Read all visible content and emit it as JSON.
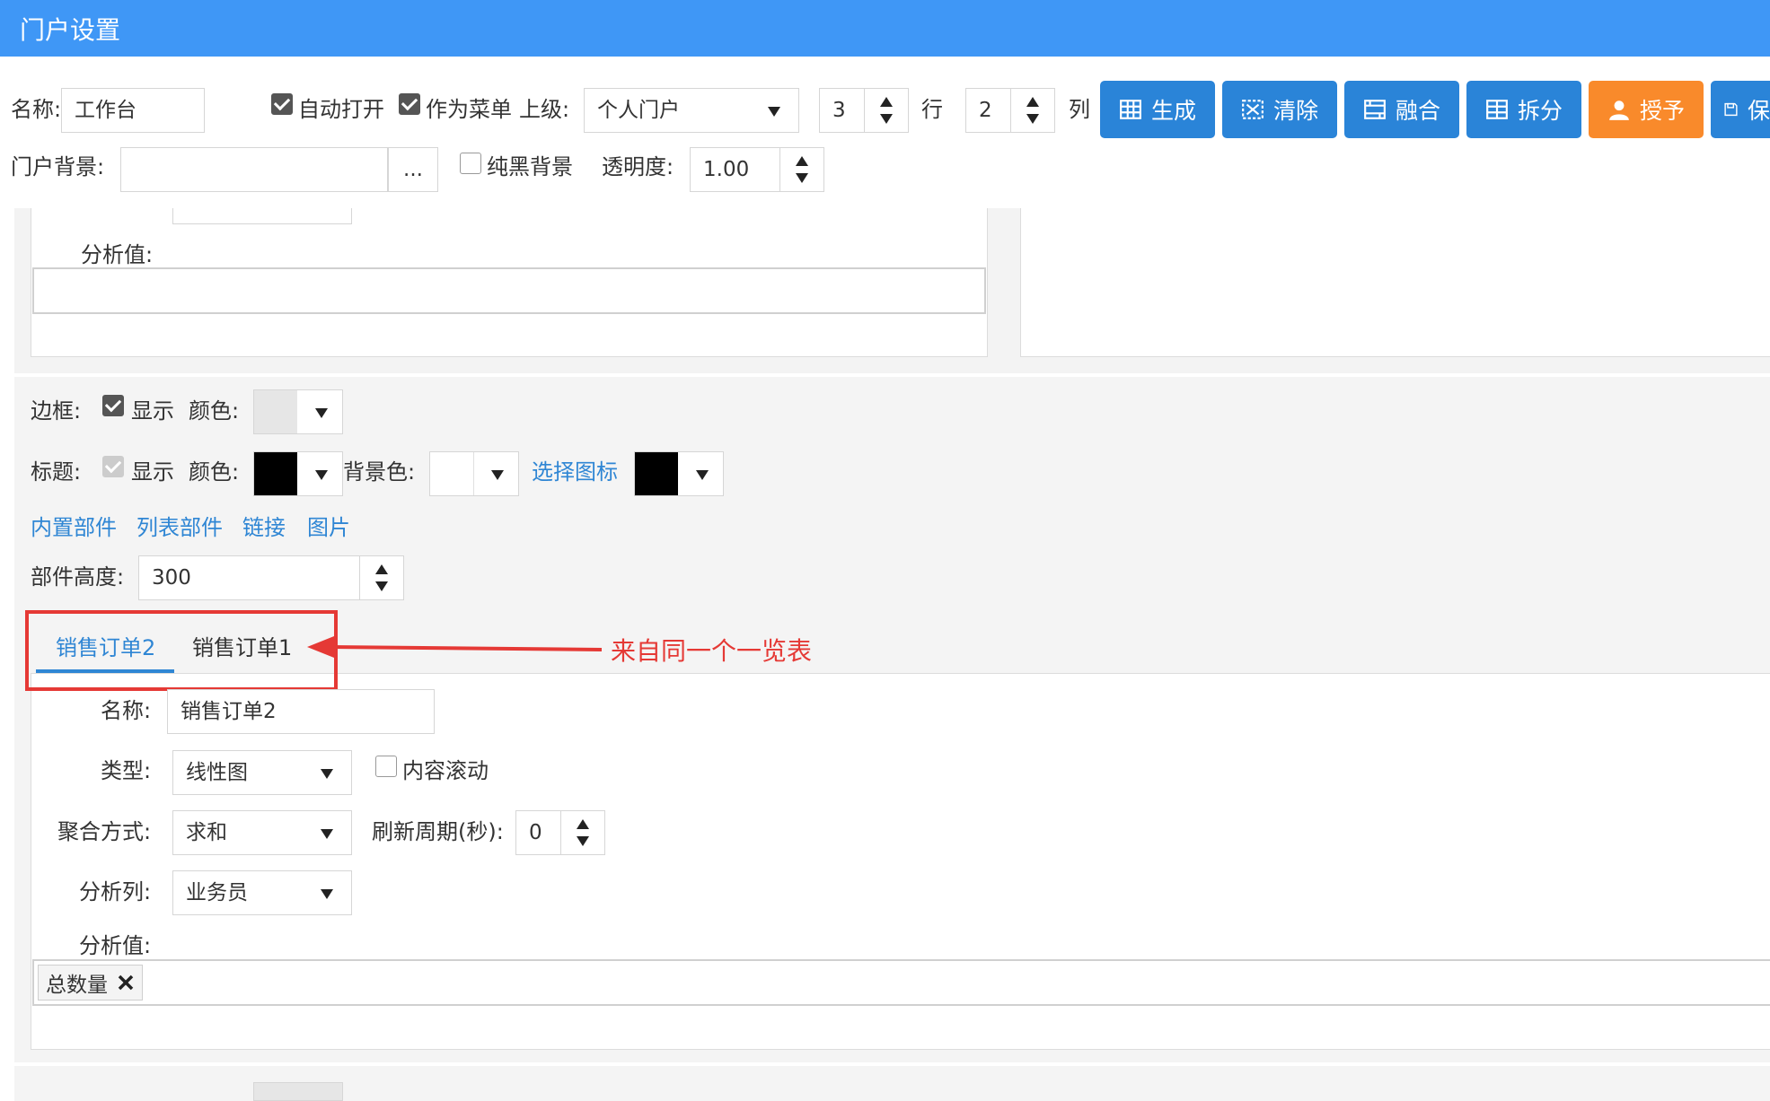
{
  "window": {
    "title": "门户设置"
  },
  "toolbar": {
    "name_label": "名称:",
    "name_value": "工作台",
    "auto_open_label": "自动打开",
    "as_menu_label": "作为菜单",
    "parent_label": "上级:",
    "parent_value": "个人门户",
    "rows_value": "3",
    "rows_label": "行",
    "cols_value": "2",
    "cols_label": "列",
    "buttons": {
      "generate": "生成",
      "clear": "清除",
      "merge": "融合",
      "split": "拆分",
      "grant": "授予",
      "save": "保"
    },
    "bg_label": "门户背景:",
    "bg_value": "",
    "browse_label": "...",
    "pure_black_label": "纯黑背景",
    "opacity_label": "透明度:",
    "opacity_value": "1.00"
  },
  "upper_panel": {
    "analysis_value_label": "分析值:"
  },
  "settings": {
    "border_label": "边框:",
    "border_show_label": "显示",
    "border_color_label": "颜色:",
    "title_label": "标题:",
    "title_show_label": "显示",
    "title_color_label": "颜色:",
    "bg_color_label": "背景色:",
    "choose_icon_link": "选择图标",
    "links": [
      "内置部件",
      "列表部件",
      "链接",
      "图片"
    ],
    "height_label": "部件高度:",
    "height_value": "300"
  },
  "colors": {
    "border_swatch": "#e6e6e6",
    "title_swatch": "#000000",
    "bg_swatch": "#ffffff",
    "icon_swatch": "#000000",
    "highlight": "#e53935",
    "link": "#2f86d4"
  },
  "tabs": {
    "items": [
      "销售订单2",
      "销售订单1"
    ],
    "annotation": "来自同一个一览表"
  },
  "form": {
    "name_label": "名称:",
    "name_value": "销售订单2",
    "type_label": "类型:",
    "type_value": "线性图",
    "scroll_label": "内容滚动",
    "agg_label": "聚合方式:",
    "agg_value": "求和",
    "refresh_label": "刷新周期(秒):",
    "refresh_value": "0",
    "analysis_col_label": "分析列:",
    "analysis_col_value": "业务员",
    "analysis_value_label": "分析值:",
    "tag_value": "总数量"
  }
}
